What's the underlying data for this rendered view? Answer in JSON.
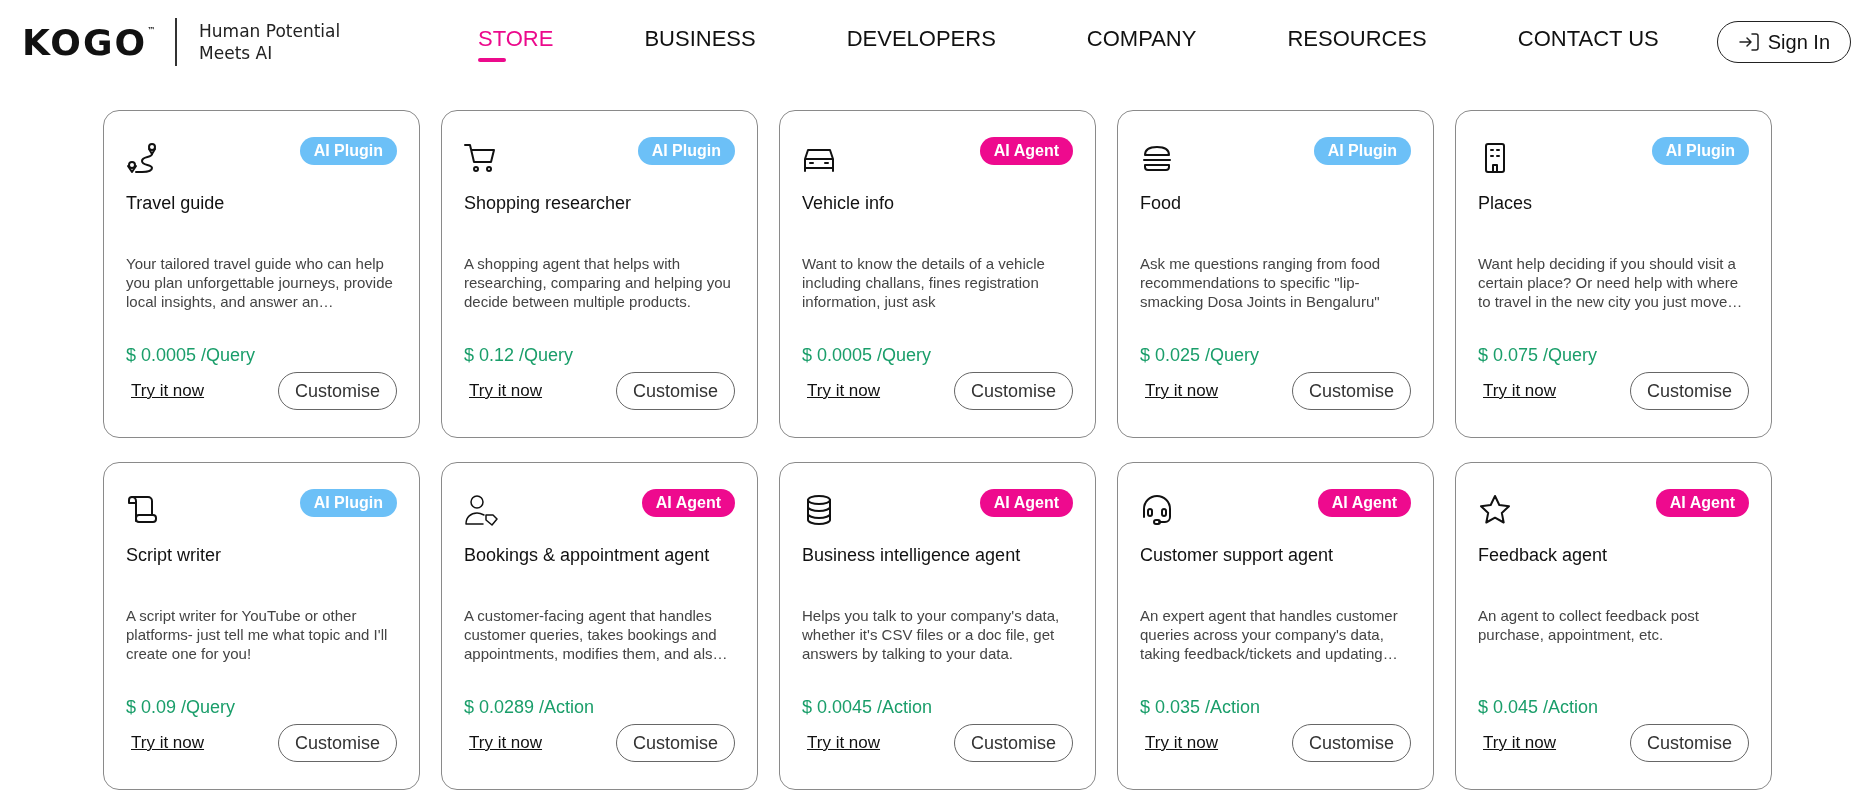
{
  "header": {
    "logo": "KOGO",
    "logo_mark": "™",
    "tagline_lines": [
      "Human Potential",
      "Meets AI"
    ],
    "nav": [
      {
        "label": "STORE",
        "selected": true
      },
      {
        "label": "BUSINESS",
        "selected": false
      },
      {
        "label": "DEVELOPERS",
        "selected": false
      },
      {
        "label": "COMPANY",
        "selected": false
      },
      {
        "label": "RESOURCES",
        "selected": false
      },
      {
        "label": "CONTACT US",
        "selected": false
      }
    ],
    "sign_in": "Sign In"
  },
  "cards": [
    {
      "kind": "route",
      "badge": {
        "kind": "plugin",
        "label": "AI Plugin"
      },
      "title": "Travel guide",
      "description": "Your tailored travel guide who can help you plan unforgettable journeys, provide local insights, and answer an…",
      "price": "$ 0.0005 /Query",
      "try": "Try it now",
      "customise": "Customise"
    },
    {
      "kind": "cart",
      "badge": {
        "kind": "plugin",
        "label": "AI Plugin"
      },
      "title": "Shopping researcher",
      "description": "A shopping agent that helps with researching, comparing and helping you decide between multiple products.",
      "price": "$ 0.12 /Query",
      "try": "Try it now",
      "customise": "Customise"
    },
    {
      "kind": "car",
      "badge": {
        "kind": "agent",
        "label": "AI Agent"
      },
      "title": "Vehicle info",
      "description": "Want to know the details of a vehicle including challans, fines registration information, just ask",
      "price": "$ 0.0005 /Query",
      "try": "Try it now",
      "customise": "Customise"
    },
    {
      "kind": "burger",
      "badge": {
        "kind": "plugin",
        "label": "AI Plugin"
      },
      "title": "Food",
      "description": "Ask me questions ranging from food recommendations to specific \"lip-smacking Dosa Joints in Bengaluru\"",
      "price": "$ 0.025 /Query",
      "try": "Try it now",
      "customise": "Customise"
    },
    {
      "kind": "building",
      "badge": {
        "kind": "plugin",
        "label": "AI Plugin"
      },
      "title": "Places",
      "description": "Want help deciding if you should visit a certain place? Or need help with where to travel in the new city you just move…",
      "price": "$ 0.075 /Query",
      "try": "Try it now",
      "customise": "Customise"
    },
    {
      "kind": "scroll",
      "badge": {
        "kind": "plugin",
        "label": "AI Plugin"
      },
      "title": "Script writer",
      "description": "A script writer for YouTube or other platforms- just tell me what topic and I'll create one for you!",
      "price": "$ 0.09 /Query",
      "try": "Try it now",
      "customise": "Customise"
    },
    {
      "kind": "person-tag",
      "badge": {
        "kind": "agent",
        "label": "AI Agent"
      },
      "title": "Bookings & appointment agent",
      "description": "A customer-facing agent that handles customer queries, takes bookings and appointments, modifies them, and als…",
      "price": "$ 0.0289 /Action",
      "try": "Try it now",
      "customise": "Customise"
    },
    {
      "kind": "database",
      "badge": {
        "kind": "agent",
        "label": "AI Agent"
      },
      "title": "Business intelligence agent",
      "description": "Helps you talk to your company's data, whether it's CSV files or a doc file, get answers by talking to your data.",
      "price": "$ 0.0045 /Action",
      "try": "Try it now",
      "customise": "Customise"
    },
    {
      "kind": "headset",
      "badge": {
        "kind": "agent",
        "label": "AI Agent"
      },
      "title": "Customer support agent",
      "description": "An expert agent that handles customer queries across your company's data, taking feedback/tickets and updating…",
      "price": "$ 0.035 /Action",
      "try": "Try it now",
      "customise": "Customise"
    },
    {
      "kind": "star",
      "badge": {
        "kind": "agent",
        "label": "AI Agent"
      },
      "title": "Feedback agent",
      "description": "An agent to collect feedback post purchase, appointment, etc.",
      "price": "$ 0.045 /Action",
      "try": "Try it now",
      "customise": "Customise"
    }
  ]
}
